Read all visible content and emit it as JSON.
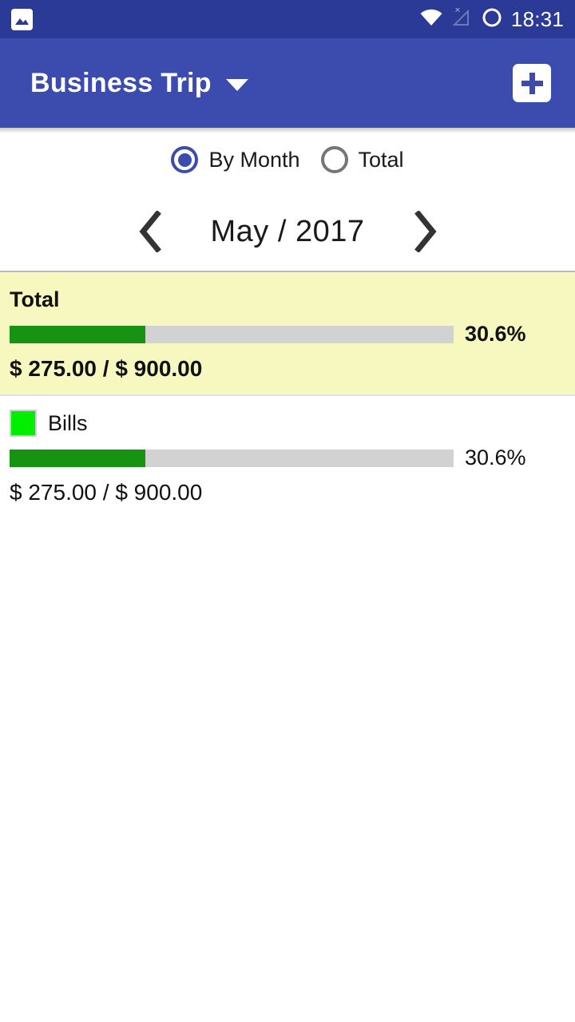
{
  "status_bar": {
    "notification_icon": "photo-icon",
    "wifi_icon": "wifi-icon",
    "cellular_icon": "cellular-no-signal-icon",
    "battery_icon": "battery-circle-icon",
    "time": "18:31",
    "background_color": "#2b3a96"
  },
  "app_bar": {
    "title": "Business Trip",
    "dropdown_icon": "chevron-down-icon",
    "add_label": "+",
    "background_color": "#3b4cae"
  },
  "mode_selector": {
    "options": [
      {
        "label": "By Month",
        "selected": true
      },
      {
        "label": "Total",
        "selected": false
      }
    ],
    "selected_color": "#3b4cae",
    "unselected_color": "#757575"
  },
  "month_navigator": {
    "prev_icon": "chevron-left-icon",
    "next_icon": "chevron-right-icon",
    "period": "May / 2017"
  },
  "budget_list": {
    "total_row": {
      "title": "Total",
      "percent_label": "30.6%",
      "percent_value": 30.6,
      "amounts": "$ 275.00 / $ 900.00",
      "spent": "$ 275.00",
      "budget": "$ 900.00",
      "background_color": "#f6f8bf",
      "bar_fill_color": "#189212",
      "bar_track_color": "#d2d2d2"
    },
    "categories": [
      {
        "title": "Bills",
        "swatch_color": "#00ef00",
        "percent_label": "30.6%",
        "percent_value": 30.6,
        "amounts": "$ 275.00 / $ 900.00",
        "spent": "$ 275.00",
        "budget": "$ 900.00"
      }
    ]
  }
}
